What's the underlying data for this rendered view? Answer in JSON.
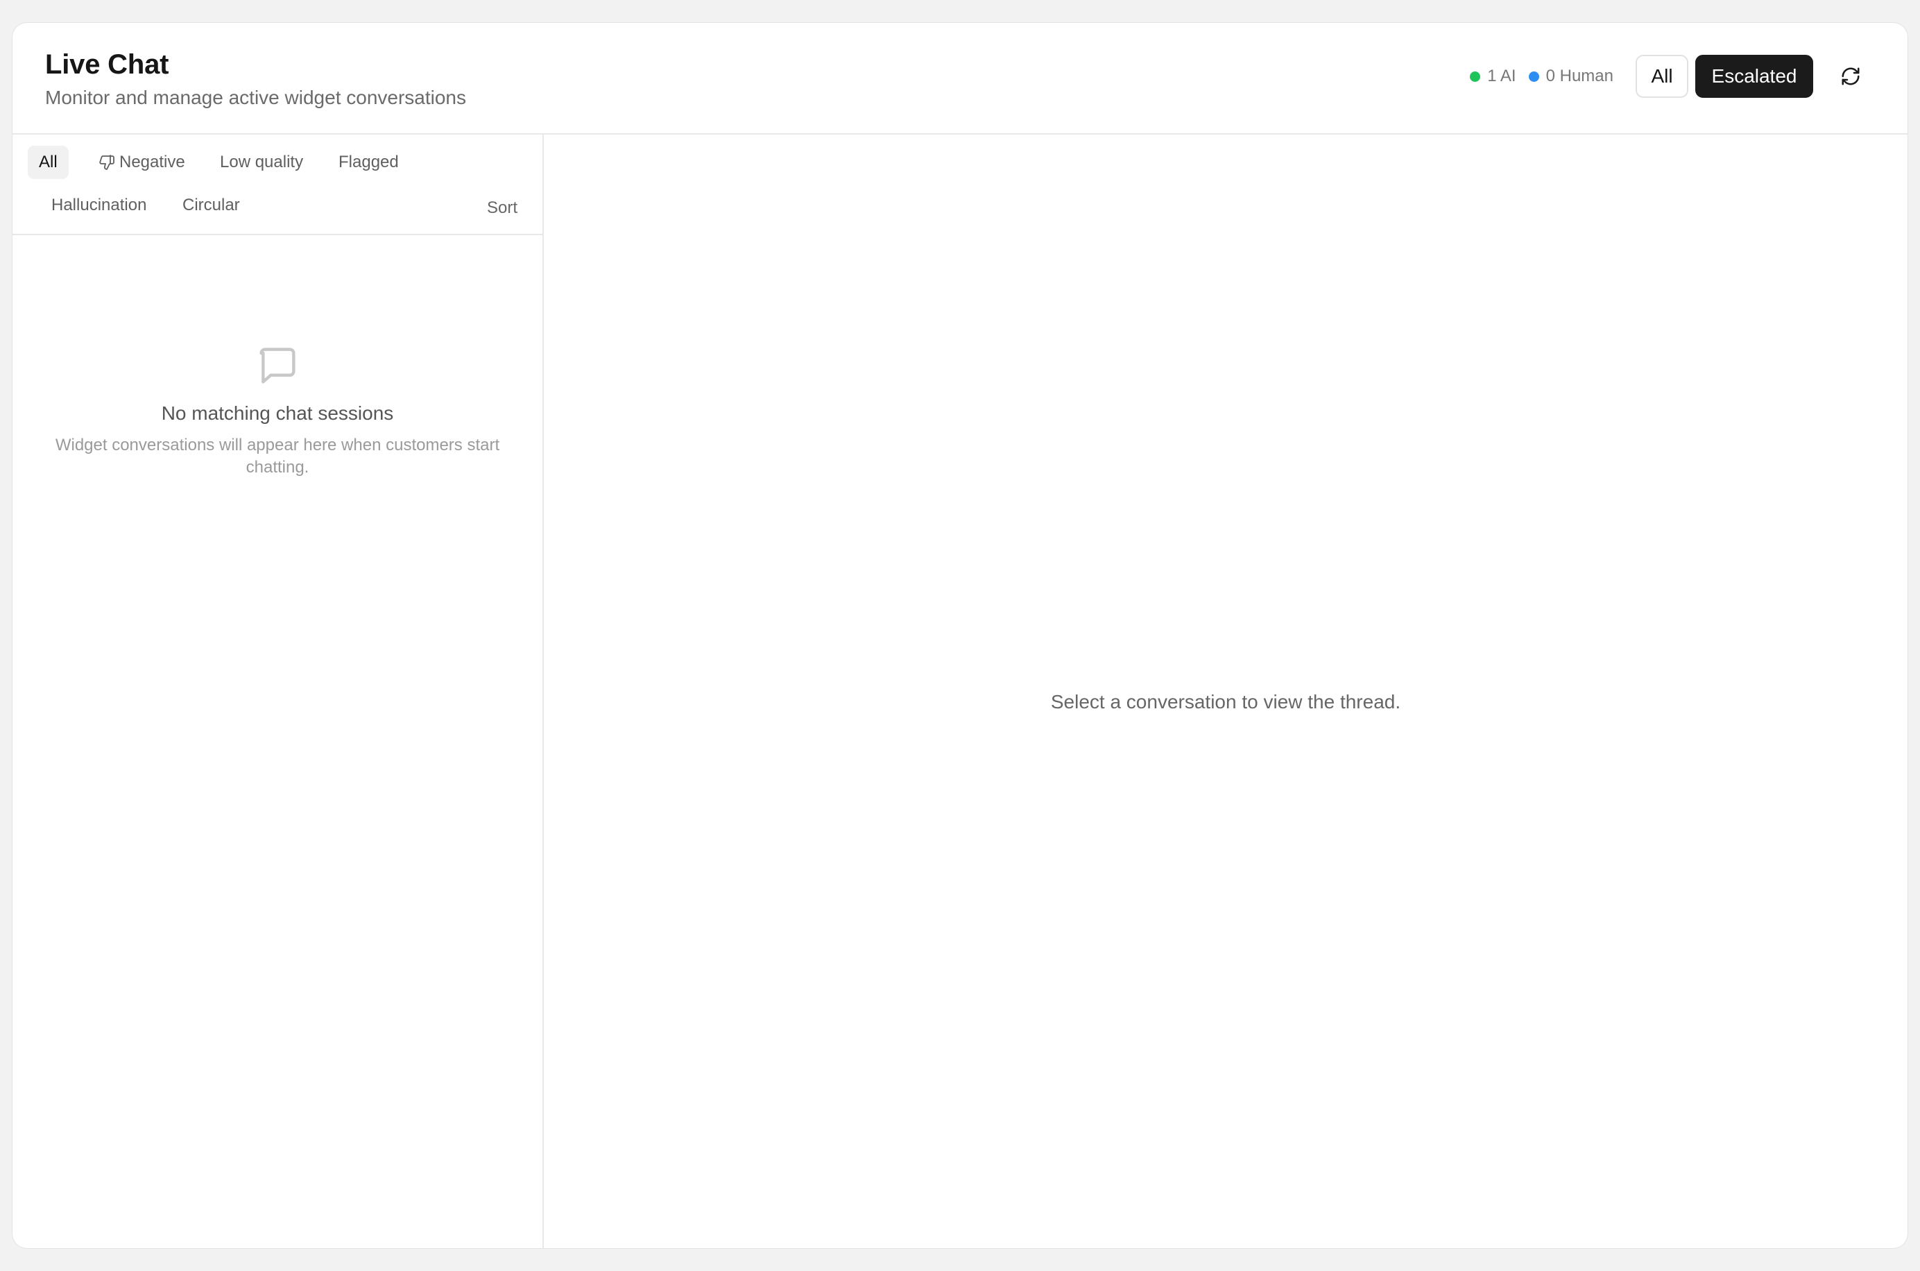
{
  "header": {
    "title": "Live Chat",
    "subtitle": "Monitor and manage active widget conversations",
    "status": {
      "ai_label": "1 AI",
      "ai_color": "#1ec45a",
      "human_label": "0 Human",
      "human_color": "#2d8ef2"
    },
    "view_toggle": {
      "all_label": "All",
      "escalated_label": "Escalated",
      "selected": "Escalated"
    },
    "refresh_icon": "refresh-icon"
  },
  "sidebar": {
    "filters": {
      "all": "All",
      "negative": "Negative",
      "low_quality": "Low quality",
      "flagged": "Flagged",
      "hallucination": "Hallucination",
      "circular": "Circular",
      "active": "All"
    },
    "sort_label": "Sort",
    "empty_state": {
      "icon": "chat-bubble-icon",
      "title": "No matching chat sessions",
      "description": "Widget conversations will appear here when customers start chatting."
    }
  },
  "main": {
    "placeholder": "Select a conversation to view the thread."
  }
}
